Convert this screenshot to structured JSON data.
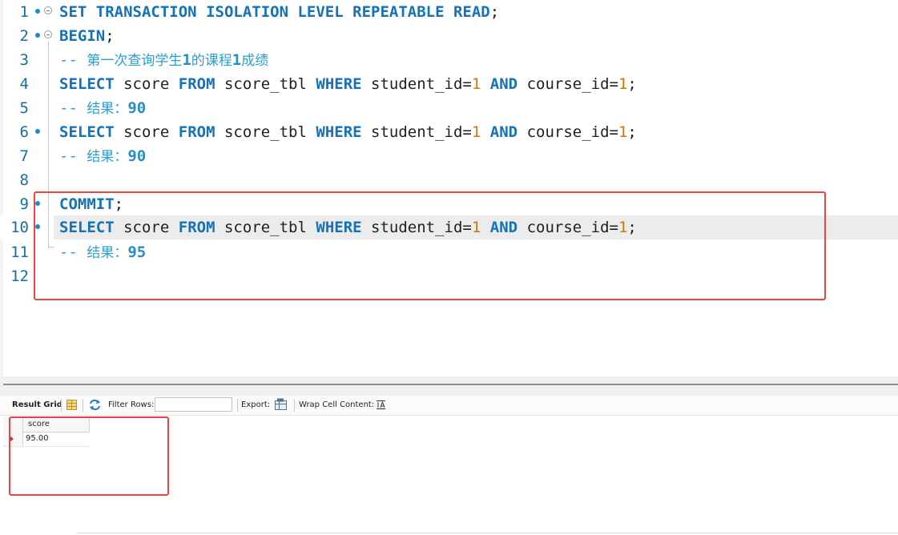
{
  "editor": {
    "lines": [
      {
        "num": "1",
        "text": "SET TRANSACTION ISOLATION LEVEL REPEATABLE READ;"
      },
      {
        "num": "2",
        "text": "BEGIN;"
      },
      {
        "num": "3",
        "text": "-- 第一次查询学生1的课程1成绩"
      },
      {
        "num": "4",
        "text": "SELECT score FROM score_tbl WHERE student_id=1 AND course_id=1;"
      },
      {
        "num": "5",
        "text": "-- 结果：90"
      },
      {
        "num": "6",
        "text": "SELECT score FROM score_tbl WHERE student_id=1 AND course_id=1;"
      },
      {
        "num": "7",
        "text": "-- 结果：90"
      },
      {
        "num": "8",
        "text": ""
      },
      {
        "num": "9",
        "text": "COMMIT;"
      },
      {
        "num": "10",
        "text": "SELECT score FROM score_tbl WHERE student_id=1 AND course_id=1;"
      },
      {
        "num": "11",
        "text": "-- 结果：95"
      },
      {
        "num": "12",
        "text": ""
      }
    ],
    "t": {
      "set": "SET",
      "transaction": "TRANSACTION",
      "isolation": "ISOLATION",
      "level": "LEVEL",
      "repeatable": "REPEATABLE",
      "read": "READ",
      "semicolon": ";",
      "begin": "BEGIN",
      "commit": "COMMIT",
      "select": "SELECT",
      "score": "score",
      "from": "FROM",
      "table": "score_tbl",
      "where": "WHERE",
      "student_col": "student_id=",
      "one": "1",
      "and": "AND",
      "course_col": "course_id=",
      "dashes": "--",
      "comment3_a": "第一次查询学生",
      "comment3_b": "的课程",
      "comment3_c": "成绩",
      "result_label": "结果：",
      "result_90": "90",
      "result_95": "95"
    }
  },
  "toolbar": {
    "result_grid": "Result Grid",
    "filter_rows": "Filter Rows:",
    "filter_value": "",
    "export": "Export:",
    "wrap_cell": "Wrap Cell Content:"
  },
  "grid": {
    "columns": [
      "score"
    ],
    "rows": [
      [
        "95.00"
      ]
    ]
  },
  "colors": {
    "keyword": "#1472b8",
    "number": "#c77c00",
    "comment": "#2a9fd0",
    "annotation_box": "#e84545"
  },
  "icons": [
    "breakpoint-dot-icon",
    "fold-toggle-icon",
    "grid-view-icon",
    "refresh-icon",
    "export-icon",
    "wrap-cell-icon",
    "current-row-arrow-icon"
  ]
}
